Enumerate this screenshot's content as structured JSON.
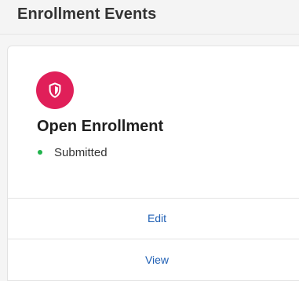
{
  "header": {
    "title": "Enrollment Events"
  },
  "event_card": {
    "icon": "shield-icon",
    "icon_color": "#e01f59",
    "title": "Open Enrollment",
    "status": {
      "label": "Submitted",
      "color": "#21b34c"
    },
    "actions": {
      "edit_label": "Edit",
      "view_label": "View"
    }
  }
}
